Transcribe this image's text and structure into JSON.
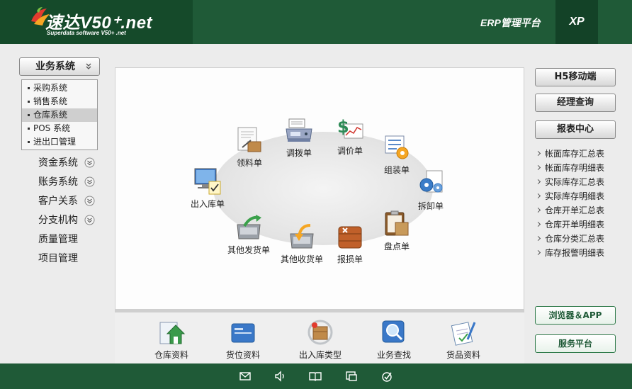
{
  "header": {
    "logo_title": "速达V50⁺.net",
    "logo_subtitle": "Superdata software V50+ .net",
    "platform": "ERP管理平台",
    "version_tab": "XP"
  },
  "left_sidebar": {
    "menu_button": "业务系统",
    "sub_items": [
      "采购系统",
      "销售系统",
      "仓库系统",
      "POS 系统",
      "进出口管理"
    ],
    "active_sub_index": 2,
    "menu_items": [
      "资金系统",
      "账务系统",
      "客户关系",
      "分支机构",
      "质量管理",
      "项目管理"
    ]
  },
  "main": {
    "flow": {
      "transfer": "调拨单",
      "price_adjust": "调价单",
      "assembly": "组装单",
      "material_pick": "领料单",
      "stock_inout": "出入库单",
      "disassembly": "拆卸单",
      "other_ship": "其他发货单",
      "other_receive": "其他收货单",
      "damage": "报损单",
      "inventory_count": "盘点单"
    },
    "bottom": {
      "warehouse_info": "仓库资料",
      "location_info": "货位资料",
      "inout_type": "出入库类型",
      "business_lookup": "业务查找",
      "goods_info": "货品资料"
    }
  },
  "right_sidebar": {
    "h5_mobile": "H5移动端",
    "manager_query": "经理查询",
    "report_center": "报表中心",
    "reports": [
      "帐面库存汇总表",
      "帐面库存明细表",
      "实际库存汇总表",
      "实际库存明细表",
      "仓库开单汇总表",
      "仓库开单明细表",
      "仓库分类汇总表",
      "库存报警明细表"
    ],
    "browser_app": "浏览器＆APP",
    "service_platform": "服务平台"
  },
  "colors": {
    "header_green": "#1f5a37",
    "logo_green": "#154a2a",
    "footer_green": "#1f5a37",
    "accent_orange": "#f5a623"
  },
  "footer": {
    "icons": [
      "mail-icon",
      "speaker-icon",
      "book-icon",
      "window-icon",
      "check-circle-icon"
    ]
  }
}
